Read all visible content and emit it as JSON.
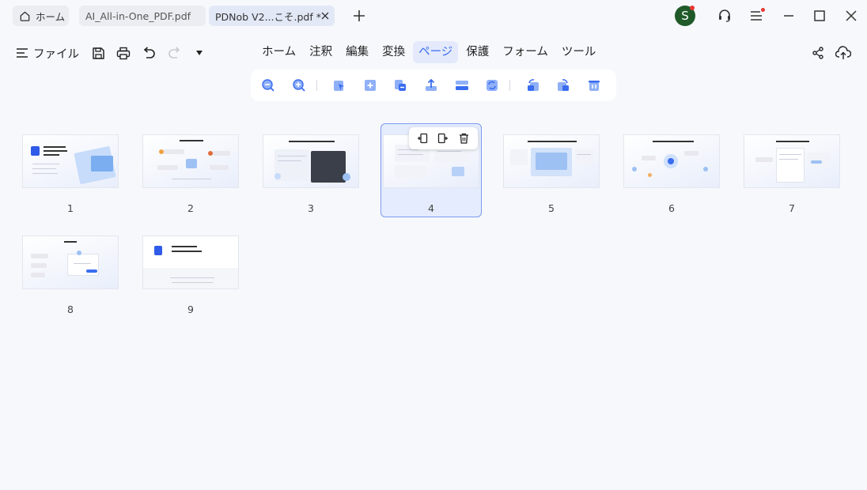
{
  "tabs": {
    "home_label": "ホーム",
    "file1_label": "AI_All-in-One_PDF.pdf",
    "active_label": "PDNob V2...こそ.pdf *"
  },
  "user": {
    "avatar_initial": "S"
  },
  "toolbar": {
    "file_label": "ファイル",
    "menus": [
      "ホーム",
      "注釈",
      "編集",
      "変換",
      "ページ",
      "保護",
      "フォーム",
      "ツール"
    ],
    "active_menu": "ページ"
  },
  "pages": {
    "numbers": [
      "1",
      "2",
      "3",
      "4",
      "5",
      "6",
      "7",
      "8",
      "9"
    ],
    "selected": "4"
  },
  "colors": {
    "accent": "#3a6cf0",
    "selection_bg": "#e5ecfd",
    "avatar_bg": "#1f5a28"
  }
}
